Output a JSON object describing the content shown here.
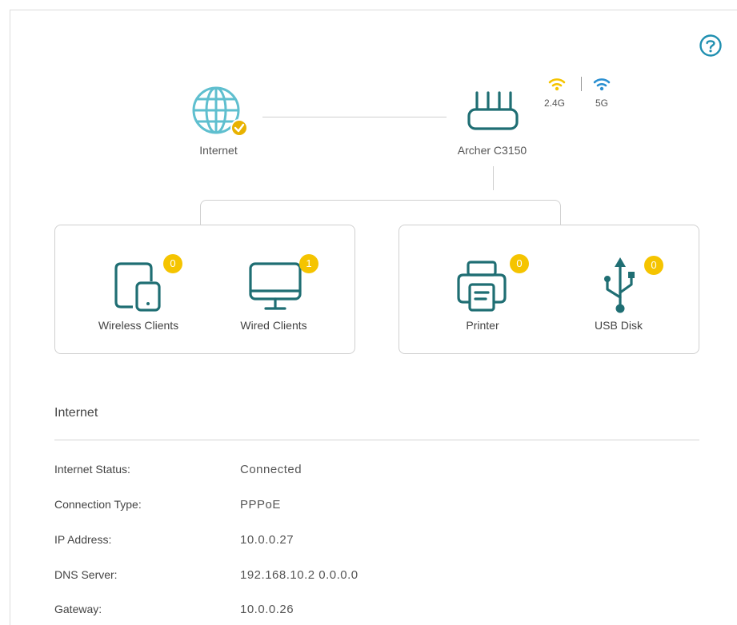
{
  "topology": {
    "internet_label": "Internet",
    "router_label": "Archer C3150",
    "band_24_label": "2.4G",
    "band_5_label": "5G",
    "colors": {
      "icon_teal": "#1f6e73",
      "globe_blue": "#5fbfcf",
      "accent_yellow": "#f5c400",
      "wifi_blue": "#2a8fd1",
      "check_badge": "#e8b200"
    }
  },
  "clients_left": [
    {
      "label": "Wireless Clients",
      "count": "0",
      "icon": "tablet-phone-icon"
    },
    {
      "label": "Wired Clients",
      "count": "1",
      "icon": "monitor-icon"
    }
  ],
  "clients_right": [
    {
      "label": "Printer",
      "count": "0",
      "icon": "printer-icon"
    },
    {
      "label": "USB Disk",
      "count": "0",
      "icon": "usb-icon"
    }
  ],
  "internet_section": {
    "title": "Internet",
    "rows": [
      {
        "label": "Internet Status:",
        "value": "Connected"
      },
      {
        "label": "Connection Type:",
        "value": "PPPoE"
      },
      {
        "label": "IP Address:",
        "value": "10.0.0.27"
      },
      {
        "label": "DNS Server:",
        "value": "192.168.10.2 0.0.0.0"
      },
      {
        "label": "Gateway:",
        "value": "10.0.0.26"
      }
    ]
  }
}
